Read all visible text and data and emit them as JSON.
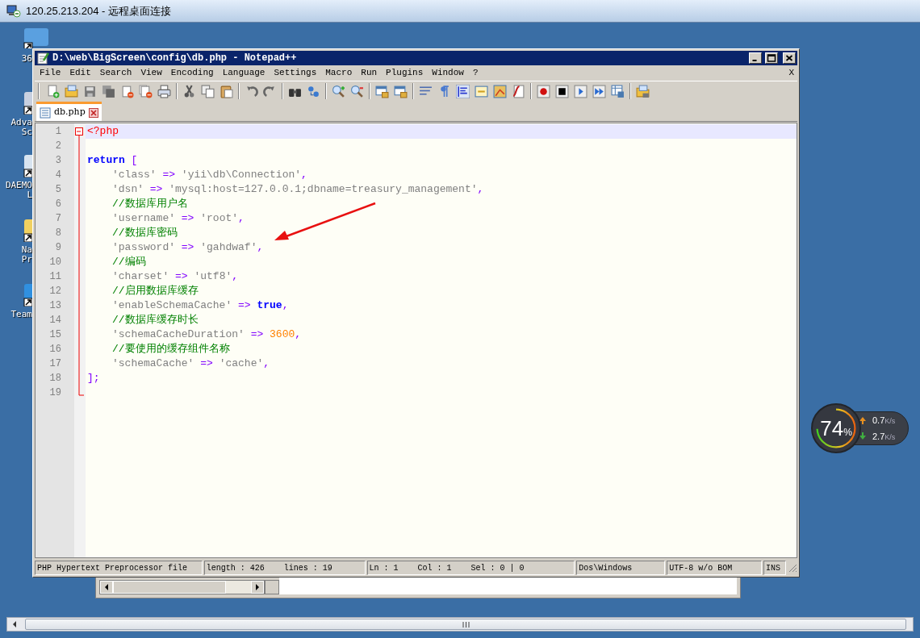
{
  "remote_window": {
    "title": "120.25.213.204 - 远程桌面连接"
  },
  "desktop_icons": [
    {
      "label_lines": [
        "36"
      ]
    },
    {
      "label_lines": [
        "Adva",
        "Sc"
      ]
    },
    {
      "label_lines": [
        "DAEMO",
        "L"
      ]
    },
    {
      "label_lines": [
        "Na",
        "Pr"
      ]
    },
    {
      "label_lines": [
        "Team"
      ]
    }
  ],
  "editor_window": {
    "title": "D:\\web\\BigScreen\\config\\db.php - Notepad++",
    "menu": [
      {
        "label": "File"
      },
      {
        "label": "Edit"
      },
      {
        "label": "Search"
      },
      {
        "label": "View"
      },
      {
        "label": "Encoding"
      },
      {
        "label": "Language"
      },
      {
        "label": "Settings"
      },
      {
        "label": "Macro"
      },
      {
        "label": "Run"
      },
      {
        "label": "Plugins"
      },
      {
        "label": "Window"
      },
      {
        "label": "?"
      }
    ],
    "close_document": "X",
    "tabs": [
      {
        "label": "db.php",
        "selected": true
      }
    ],
    "code_lines": [
      {
        "number": "1",
        "current": true,
        "indent": false,
        "tokens": [
          {
            "kind": "tag",
            "text": "<?php"
          }
        ]
      },
      {
        "number": "2",
        "current": false
      },
      {
        "number": "3",
        "current": false,
        "indent": false,
        "tokens": [
          {
            "kind": "keyword",
            "text": "return"
          },
          {
            "kind": "punct",
            "text": " ["
          }
        ]
      },
      {
        "number": "4",
        "current": false,
        "indent": true,
        "tokens": [
          {
            "kind": "string",
            "text": "'class'"
          },
          {
            "kind": "op",
            "text": " => "
          },
          {
            "kind": "string",
            "text": "'yii\\db\\Connection'"
          },
          {
            "kind": "punct",
            "text": ","
          }
        ]
      },
      {
        "number": "5",
        "current": false,
        "indent": true,
        "tokens": [
          {
            "kind": "string",
            "text": "'dsn'"
          },
          {
            "kind": "op",
            "text": " => "
          },
          {
            "kind": "string",
            "text": "'mysql:host=127.0.0.1;dbname=treasury_management'"
          },
          {
            "kind": "punct",
            "text": ","
          }
        ]
      },
      {
        "number": "6",
        "current": false,
        "indent": true,
        "tokens": [
          {
            "kind": "comment",
            "text": "//数据库用户名"
          }
        ]
      },
      {
        "number": "7",
        "current": false,
        "indent": true,
        "tokens": [
          {
            "kind": "string",
            "text": "'username'"
          },
          {
            "kind": "op",
            "text": " => "
          },
          {
            "kind": "string",
            "text": "'root'"
          },
          {
            "kind": "punct",
            "text": ","
          }
        ]
      },
      {
        "number": "8",
        "current": false,
        "indent": true,
        "tokens": [
          {
            "kind": "comment",
            "text": "//数据库密码"
          }
        ]
      },
      {
        "number": "9",
        "current": false,
        "indent": true,
        "tokens": [
          {
            "kind": "string",
            "text": "'password'"
          },
          {
            "kind": "op",
            "text": " => "
          },
          {
            "kind": "string",
            "text": "'gahdwaf'"
          },
          {
            "kind": "punct",
            "text": ","
          }
        ]
      },
      {
        "number": "10",
        "current": false,
        "indent": true,
        "tokens": [
          {
            "kind": "comment",
            "text": "//编码"
          }
        ]
      },
      {
        "number": "11",
        "current": false,
        "indent": true,
        "tokens": [
          {
            "kind": "string",
            "text": "'charset'"
          },
          {
            "kind": "op",
            "text": " => "
          },
          {
            "kind": "string",
            "text": "'utf8'"
          },
          {
            "kind": "punct",
            "text": ","
          }
        ]
      },
      {
        "number": "12",
        "current": false,
        "indent": true,
        "tokens": [
          {
            "kind": "comment",
            "text": "//启用数据库缓存"
          }
        ]
      },
      {
        "number": "13",
        "current": false,
        "indent": true,
        "tokens": [
          {
            "kind": "string",
            "text": "'enableSchemaCache'"
          },
          {
            "kind": "op",
            "text": " => "
          },
          {
            "kind": "keyword",
            "text": "true"
          },
          {
            "kind": "punct",
            "text": ","
          }
        ]
      },
      {
        "number": "14",
        "current": false,
        "indent": true,
        "tokens": [
          {
            "kind": "comment",
            "text": "//数据库缓存时长"
          }
        ]
      },
      {
        "number": "15",
        "current": false,
        "indent": true,
        "tokens": [
          {
            "kind": "string",
            "text": "'schemaCacheDuration'"
          },
          {
            "kind": "op",
            "text": " => "
          },
          {
            "kind": "number",
            "text": "3600"
          },
          {
            "kind": "punct",
            "text": ","
          }
        ]
      },
      {
        "number": "16",
        "current": false,
        "indent": true,
        "tokens": [
          {
            "kind": "comment",
            "text": "//要使用的缓存组件名称"
          }
        ]
      },
      {
        "number": "17",
        "current": false,
        "indent": true,
        "tokens": [
          {
            "kind": "string",
            "text": "'schemaCache'"
          },
          {
            "kind": "op",
            "text": " => "
          },
          {
            "kind": "string",
            "text": "'cache'"
          },
          {
            "kind": "punct",
            "text": ","
          }
        ]
      },
      {
        "number": "18",
        "current": false,
        "indent": false,
        "tokens": [
          {
            "kind": "punct",
            "text": "];"
          }
        ]
      },
      {
        "number": "19",
        "current": false
      }
    ],
    "status_bar": [
      "PHP Hypertext Preprocessor file",
      "length : 426    lines : 19",
      "Ln : 1    Col : 1    Sel : 0 | 0",
      "Dos\\Windows",
      "UTF-8 w/o BOM",
      "INS"
    ]
  },
  "net_monitor": {
    "percent": "74",
    "percent_sign": "%",
    "upload": {
      "value": "0.7",
      "unit": "K/s"
    },
    "download": {
      "value": "2.7",
      "unit": "K/s"
    }
  }
}
